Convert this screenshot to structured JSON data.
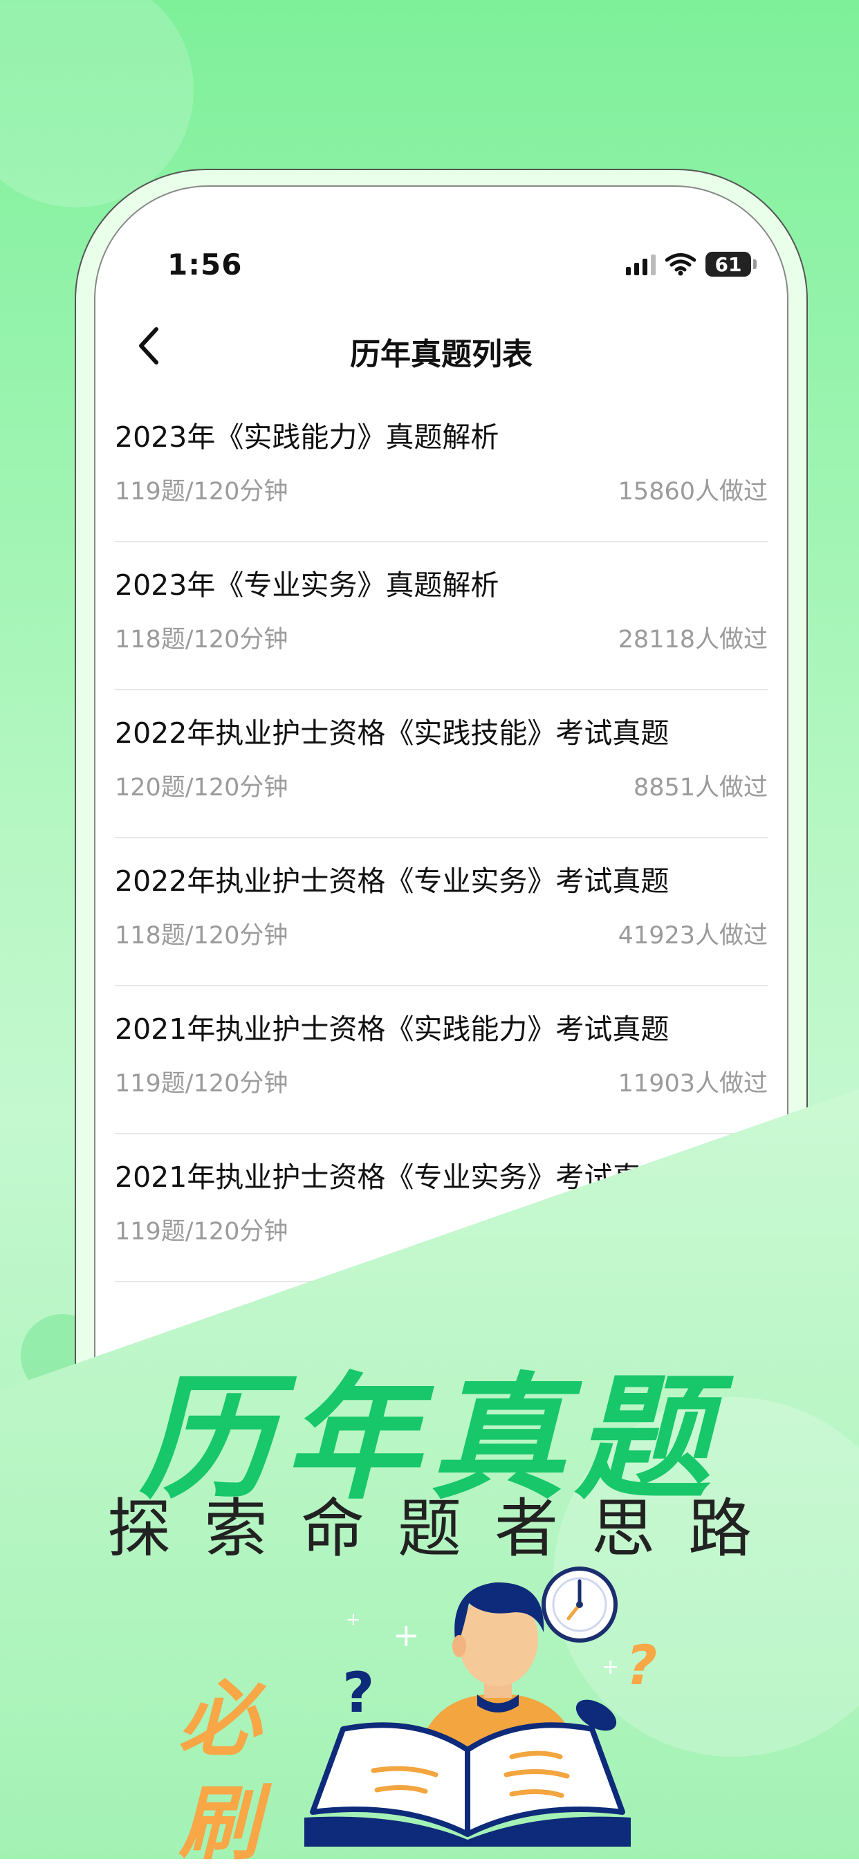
{
  "status": {
    "time": "1:56",
    "battery": "61"
  },
  "nav": {
    "title": "历年真题列表"
  },
  "exams": [
    {
      "title": "2023年《实践能力》真题解析",
      "meta": "119题/120分钟",
      "count": "15860人做过"
    },
    {
      "title": "2023年《专业实务》真题解析",
      "meta": "118题/120分钟",
      "count": "28118人做过"
    },
    {
      "title": "2022年执业护士资格《实践技能》考试真题",
      "meta": "120题/120分钟",
      "count": "8851人做过"
    },
    {
      "title": "2022年执业护士资格《专业实务》考试真题",
      "meta": "118题/120分钟",
      "count": "41923人做过"
    },
    {
      "title": "2021年执业护士资格《实践能力》考试真题",
      "meta": "119题/120分钟",
      "count": "11903人做过"
    },
    {
      "title": "2021年执业护士资格《专业实务》考试真",
      "meta": "119题/120分钟",
      "count": ""
    }
  ],
  "promo": {
    "headline": "历年真题",
    "subheadline": "探索命题者思路",
    "side_text_1": "必",
    "side_text_2": "刷"
  },
  "colors": {
    "accent_green": "#17c76a",
    "orange": "#f8a646",
    "navy": "#0e2a7a"
  },
  "icons": [
    "back-chevron-icon",
    "signal-icon",
    "wifi-icon",
    "battery-icon",
    "clock-icon",
    "question-mark-icon",
    "sparkle-icon"
  ]
}
